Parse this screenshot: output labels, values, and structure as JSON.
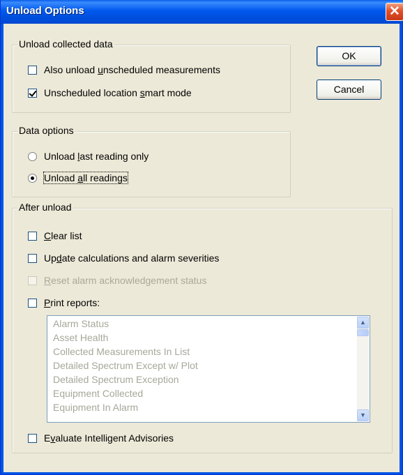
{
  "window": {
    "title": "Unload Options",
    "close_glyph": "✕"
  },
  "buttons": {
    "ok": "OK",
    "cancel": "Cancel"
  },
  "collected": {
    "legend": "Unload collected data",
    "also_pre": "Also unload ",
    "also_u": "u",
    "also_post": "nscheduled measurements",
    "also_checked": false,
    "smart_pre": "Unscheduled location ",
    "smart_u": "s",
    "smart_post": "mart mode",
    "smart_checked": true
  },
  "data_options": {
    "legend": "Data options",
    "last_pre": "Unload ",
    "last_u": "l",
    "last_post": "ast reading only",
    "all_pre": "Unload ",
    "all_u": "a",
    "all_post": "ll readings",
    "selected": "all"
  },
  "after": {
    "legend": "After unload",
    "clear_u": "C",
    "clear_post": "lear list",
    "update_pre": "Up",
    "update_u": "d",
    "update_post": "ate calculations and alarm severities",
    "reset_u": "R",
    "reset_post": "eset alarm acknowledgement status",
    "print_u": "P",
    "print_post": "rint reports:",
    "evaluate_pre": "E",
    "evaluate_u": "v",
    "evaluate_post": "aluate Intelligent Advisories"
  },
  "reports": [
    "Alarm Status",
    "Asset Health",
    "Collected Measurements In List",
    "Detailed Spectrum Except w/ Plot",
    "Detailed Spectrum Exception",
    "Equipment Collected",
    "Equipment In Alarm"
  ],
  "icons": {
    "up": "▲",
    "down": "▼"
  },
  "colors": {
    "titlebar": "#0054e3",
    "dialog_bg": "#ece9d8",
    "close": "#e0502a",
    "disabled_text": "#aca899"
  }
}
